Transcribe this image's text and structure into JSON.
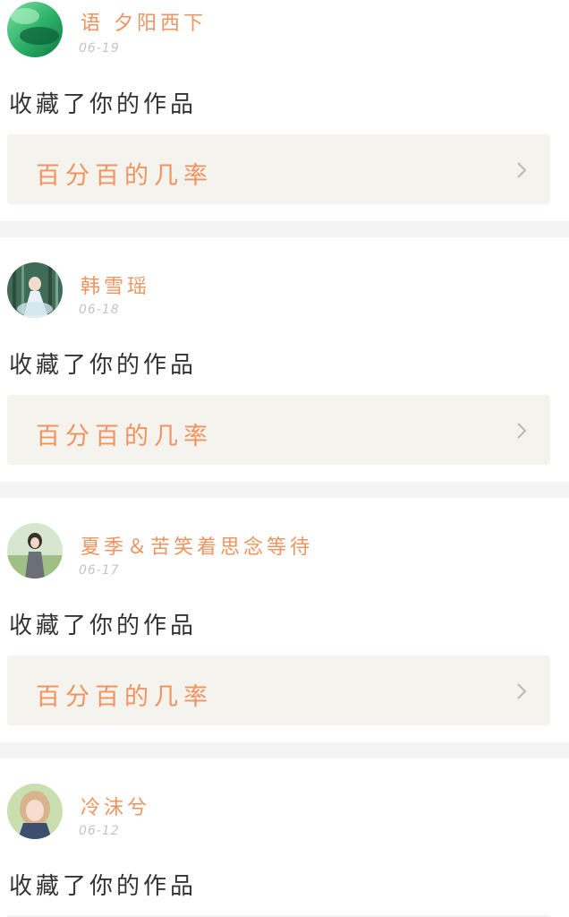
{
  "feed": {
    "items": [
      {
        "username": "语 夕阳西下",
        "date": "06-19",
        "action": "收藏了你的作品",
        "work_title": "百分百的几率",
        "avatar_icon": "green-leaf-avatar-icon"
      },
      {
        "username": "韩雪瑶",
        "date": "06-18",
        "action": "收藏了你的作品",
        "work_title": "百分百的几率",
        "avatar_icon": "bamboo-girl-avatar-icon"
      },
      {
        "username": "夏季＆苦笑着思念等待",
        "date": "06-17",
        "action": "收藏了你的作品",
        "work_title": "百分百的几率",
        "avatar_icon": "girl-field-avatar-icon"
      },
      {
        "username": "冷沫兮",
        "date": "06-12",
        "action": "收藏了你的作品",
        "work_title": "",
        "avatar_icon": "blonde-girl-avatar-icon"
      }
    ]
  },
  "colors": {
    "accent": "#f0935e",
    "text": "#333333",
    "date": "#c4c4c4",
    "card_bg": "#f4f3ee",
    "divider": "#f4f4f4"
  }
}
